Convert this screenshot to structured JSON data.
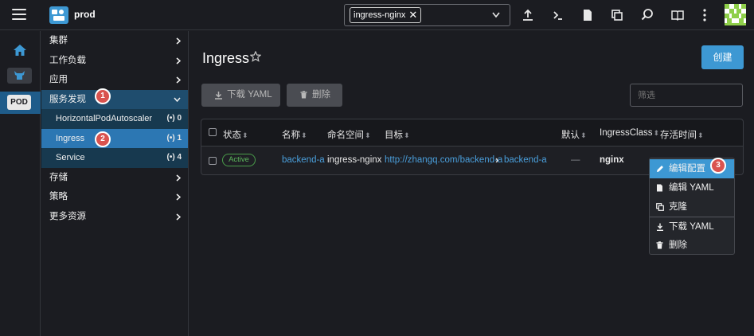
{
  "topbar": {
    "cluster_name": "prod",
    "namespace_chip": "ingress-nginx",
    "chip_remove": "✕"
  },
  "rail": {
    "pod_label": "POD"
  },
  "sidenav": {
    "items": [
      {
        "label": "集群"
      },
      {
        "label": "工作负载"
      },
      {
        "label": "应用"
      }
    ],
    "service_discovery": {
      "label": "服务发现",
      "badge": "1",
      "children": [
        {
          "label": "HorizontalPodAutoscaler",
          "count": "0"
        },
        {
          "label": "Ingress",
          "count": "1",
          "badge": "2"
        },
        {
          "label": "Service",
          "count": "4"
        }
      ]
    },
    "items_after": [
      {
        "label": "存储"
      },
      {
        "label": "策略"
      },
      {
        "label": "更多资源"
      }
    ]
  },
  "main": {
    "title": "Ingress",
    "create_label": "创建",
    "download_yaml_label": "下载 YAML",
    "delete_label": "删除",
    "filter_placeholder": "筛选",
    "table": {
      "columns": [
        "状态",
        "名称",
        "命名空间",
        "目标",
        "默认",
        "IngressClass",
        "存活时间"
      ],
      "sort_glyph": "⬍",
      "rows": [
        {
          "status": "Active",
          "name": "backend-a",
          "namespace": "ingress-nginx",
          "target_url": "http://zhangq.com/backend-a",
          "target_arrow": "›",
          "target_service": "backend-a",
          "default": "—",
          "ingress_class": "nginx"
        }
      ]
    }
  },
  "context_menu": {
    "badge": "3",
    "items": [
      {
        "label": "编辑配置"
      },
      {
        "label": "编辑 YAML"
      },
      {
        "label": "克隆"
      },
      {
        "label": "下载 YAML"
      },
      {
        "label": "删除"
      }
    ]
  },
  "colors": {
    "accent": "#3d98d3",
    "active_status": "#5cb85c",
    "badge": "#d9534f",
    "nav_group_bg": "#1f4d6e"
  }
}
